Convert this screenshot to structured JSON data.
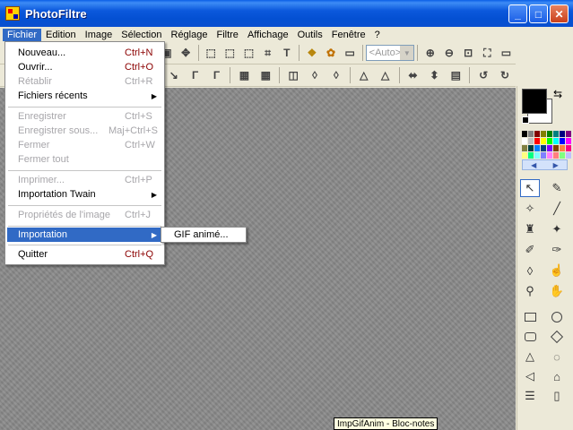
{
  "window": {
    "title": "PhotoFiltre",
    "min_icon": "minimize-icon",
    "max_icon": "maximize-icon",
    "close_icon": "close-icon"
  },
  "menubar": [
    "Fichier",
    "Edition",
    "Image",
    "Sélection",
    "Réglage",
    "Filtre",
    "Affichage",
    "Outils",
    "Fenêtre",
    "?"
  ],
  "toolbar": {
    "zoom_value": "<Auto>"
  },
  "fichier_menu": {
    "items": [
      {
        "label": "Nouveau...",
        "shortcut": "Ctrl+N",
        "enabled": true
      },
      {
        "label": "Ouvrir...",
        "shortcut": "Ctrl+O",
        "enabled": true
      },
      {
        "label": "Rétablir",
        "shortcut": "Ctrl+R",
        "enabled": false
      },
      {
        "label": "Fichiers récents",
        "shortcut": "",
        "enabled": true,
        "submenu": true
      },
      {
        "label": "Enregistrer",
        "shortcut": "Ctrl+S",
        "enabled": false
      },
      {
        "label": "Enregistrer sous...",
        "shortcut": "Maj+Ctrl+S",
        "enabled": false
      },
      {
        "label": "Fermer",
        "shortcut": "Ctrl+W",
        "enabled": false
      },
      {
        "label": "Fermer tout",
        "shortcut": "",
        "enabled": false
      },
      {
        "label": "Imprimer...",
        "shortcut": "Ctrl+P",
        "enabled": false
      },
      {
        "label": "Importation Twain",
        "shortcut": "",
        "enabled": true,
        "submenu": true
      },
      {
        "label": "Propriétés de l'image",
        "shortcut": "Ctrl+J",
        "enabled": false
      },
      {
        "label": "Importation",
        "shortcut": "",
        "enabled": true,
        "submenu": true,
        "highlighted": true
      },
      {
        "label": "Quitter",
        "shortcut": "Ctrl+Q",
        "enabled": true
      }
    ]
  },
  "importation_submenu": {
    "items": [
      "GIF animé..."
    ]
  },
  "tooltip": "ImpGifAnim - Bloc-notes",
  "colors": {
    "accent": "#316ac5",
    "workspace": "#8a8a8a",
    "palette": [
      "#000000",
      "#808080",
      "#800000",
      "#808000",
      "#008000",
      "#008080",
      "#000080",
      "#800080",
      "#ffffff",
      "#c0c0c0",
      "#ff0000",
      "#ffff00",
      "#00ff00",
      "#00ffff",
      "#0000ff",
      "#ff00ff",
      "#808040",
      "#004040",
      "#0080ff",
      "#004080",
      "#8000ff",
      "#804000",
      "#ff8040",
      "#ff0080",
      "#ffff80",
      "#00ff80",
      "#80ffff",
      "#8080ff",
      "#ff80ff",
      "#ff8080",
      "#80ff80",
      "#c0c0ff"
    ]
  }
}
